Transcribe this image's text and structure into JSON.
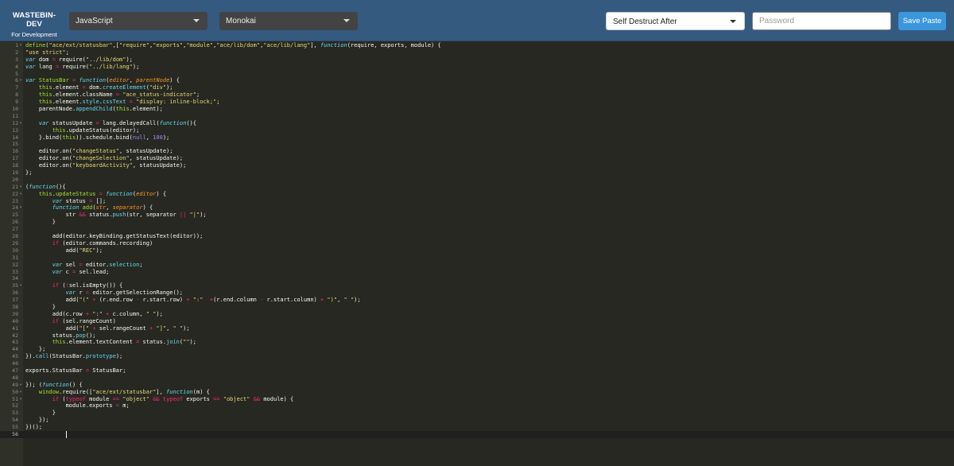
{
  "header": {
    "brand_title": "WASTEBIN-DEV",
    "brand_subtitle": "For Development",
    "language_select": "JavaScript",
    "theme_select": "Monokai",
    "self_destruct_select": "Self Destruct After",
    "password_placeholder": "Password",
    "save_label": "Save Paste"
  },
  "editor": {
    "active_line": 56,
    "fold_lines": [
      1,
      6,
      12,
      21,
      22,
      24,
      35,
      49,
      50,
      51
    ],
    "lines": [
      [
        [
          "t",
          "define"
        ],
        [
          "",
          "("
        ],
        [
          "s",
          "\"ace/ext/statusbar\""
        ],
        [
          "",
          ",["
        ],
        [
          "s",
          "\"require\""
        ],
        [
          "",
          ","
        ],
        [
          "s",
          "\"exports\""
        ],
        [
          "",
          ","
        ],
        [
          "s",
          "\"module\""
        ],
        [
          "",
          ","
        ],
        [
          "s",
          "\"ace/lib/dom\""
        ],
        [
          "",
          ","
        ],
        [
          "s",
          "\"ace/lib/lang\""
        ],
        [
          "",
          "], "
        ],
        [
          "st",
          "function"
        ],
        [
          "",
          "(require, exports, module) {"
        ]
      ],
      [
        [
          "s",
          "\"use strict\""
        ],
        [
          "",
          ";"
        ]
      ],
      [
        [
          "st",
          "var"
        ],
        [
          "",
          " dom "
        ],
        [
          "k",
          "="
        ],
        [
          "",
          " require("
        ],
        [
          "s",
          "\"../lib/dom\""
        ],
        [
          "",
          ");"
        ]
      ],
      [
        [
          "st",
          "var"
        ],
        [
          "",
          " lang "
        ],
        [
          "k",
          "="
        ],
        [
          "",
          " require("
        ],
        [
          "s",
          "\"../lib/lang\""
        ],
        [
          "",
          ");"
        ]
      ],
      [],
      [
        [
          "st",
          "var"
        ],
        [
          "",
          " "
        ],
        [
          "f",
          "StatusBar"
        ],
        [
          "",
          " "
        ],
        [
          "k",
          "="
        ],
        [
          "",
          " "
        ],
        [
          "st",
          "function"
        ],
        [
          "",
          "("
        ],
        [
          "p",
          "editor"
        ],
        [
          "",
          ", "
        ],
        [
          "p",
          "parentNode"
        ],
        [
          "",
          ") {"
        ]
      ],
      [
        [
          "",
          "    "
        ],
        [
          "t",
          "this"
        ],
        [
          "",
          ".element "
        ],
        [
          "k",
          "="
        ],
        [
          "",
          " dom."
        ],
        [
          "sup",
          "createElement"
        ],
        [
          "",
          "("
        ],
        [
          "s",
          "\"div\""
        ],
        [
          "",
          ");"
        ]
      ],
      [
        [
          "",
          "    "
        ],
        [
          "t",
          "this"
        ],
        [
          "",
          ".element.className "
        ],
        [
          "k",
          "="
        ],
        [
          "",
          " "
        ],
        [
          "s",
          "\"ace_status-indicator\""
        ],
        [
          "",
          ";"
        ]
      ],
      [
        [
          "",
          "    "
        ],
        [
          "t",
          "this"
        ],
        [
          "",
          ".element."
        ],
        [
          "sup",
          "style"
        ],
        [
          "",
          "."
        ],
        [
          "sup",
          "cssText"
        ],
        [
          "",
          " "
        ],
        [
          "k",
          "="
        ],
        [
          "",
          " "
        ],
        [
          "s",
          "\"display: inline-block;\""
        ],
        [
          "",
          ";"
        ]
      ],
      [
        [
          "",
          "    parentNode."
        ],
        [
          "sup",
          "appendChild"
        ],
        [
          "",
          "("
        ],
        [
          "t",
          "this"
        ],
        [
          "",
          ".element);"
        ]
      ],
      [],
      [
        [
          "",
          "    "
        ],
        [
          "st",
          "var"
        ],
        [
          "",
          " statusUpdate "
        ],
        [
          "k",
          "="
        ],
        [
          "",
          " lang.delayedCall("
        ],
        [
          "st",
          "function"
        ],
        [
          "",
          "(){"
        ]
      ],
      [
        [
          "",
          "        "
        ],
        [
          "t",
          "this"
        ],
        [
          "",
          ".updateStatus(editor);"
        ]
      ],
      [
        [
          "",
          "    }.bind("
        ],
        [
          "t",
          "this"
        ],
        [
          "",
          ")).schedule.bind("
        ],
        [
          "n",
          "null"
        ],
        [
          "",
          ", "
        ],
        [
          "n",
          "100"
        ],
        [
          "",
          ");"
        ]
      ],
      [],
      [
        [
          "",
          "    editor.on("
        ],
        [
          "s",
          "\"changeStatus\""
        ],
        [
          "",
          ", statusUpdate);"
        ]
      ],
      [
        [
          "",
          "    editor.on("
        ],
        [
          "s",
          "\"changeSelection\""
        ],
        [
          "",
          ", statusUpdate);"
        ]
      ],
      [
        [
          "",
          "    editor.on("
        ],
        [
          "s",
          "\"keyboardActivity\""
        ],
        [
          "",
          ", statusUpdate);"
        ]
      ],
      [
        [
          "",
          "};"
        ]
      ],
      [],
      [
        [
          "",
          "("
        ],
        [
          "st",
          "function"
        ],
        [
          "",
          "(){"
        ]
      ],
      [
        [
          "",
          "    "
        ],
        [
          "t",
          "this"
        ],
        [
          "",
          "."
        ],
        [
          "f",
          "updateStatus"
        ],
        [
          "",
          " "
        ],
        [
          "k",
          "="
        ],
        [
          "",
          " "
        ],
        [
          "st",
          "function"
        ],
        [
          "",
          "("
        ],
        [
          "p",
          "editor"
        ],
        [
          "",
          ") {"
        ]
      ],
      [
        [
          "",
          "        "
        ],
        [
          "st",
          "var"
        ],
        [
          "",
          " status "
        ],
        [
          "k",
          "="
        ],
        [
          "",
          " [];"
        ]
      ],
      [
        [
          "",
          "        "
        ],
        [
          "st",
          "function"
        ],
        [
          "",
          " "
        ],
        [
          "f",
          "add"
        ],
        [
          "",
          "("
        ],
        [
          "p",
          "str"
        ],
        [
          "",
          ", "
        ],
        [
          "p",
          "separator"
        ],
        [
          "",
          ") {"
        ]
      ],
      [
        [
          "",
          "            str "
        ],
        [
          "k",
          "&&"
        ],
        [
          "",
          " status."
        ],
        [
          "sup",
          "push"
        ],
        [
          "",
          "(str, separator "
        ],
        [
          "k",
          "||"
        ],
        [
          "",
          " "
        ],
        [
          "s",
          "\"|\""
        ],
        [
          "",
          ");"
        ]
      ],
      [
        [
          "",
          "        }"
        ]
      ],
      [],
      [
        [
          "",
          "        add(editor.keyBinding.getStatusText(editor));"
        ]
      ],
      [
        [
          "",
          "        "
        ],
        [
          "k",
          "if"
        ],
        [
          "",
          " (editor.commands.recording)"
        ]
      ],
      [
        [
          "",
          "            add("
        ],
        [
          "s",
          "\"REC\""
        ],
        [
          "",
          ");"
        ]
      ],
      [],
      [
        [
          "",
          "        "
        ],
        [
          "st",
          "var"
        ],
        [
          "",
          " sel "
        ],
        [
          "k",
          "="
        ],
        [
          "",
          " editor."
        ],
        [
          "sup",
          "selection"
        ],
        [
          "",
          ";"
        ]
      ],
      [
        [
          "",
          "        "
        ],
        [
          "st",
          "var"
        ],
        [
          "",
          " c "
        ],
        [
          "k",
          "="
        ],
        [
          "",
          " sel.lead;"
        ]
      ],
      [],
      [
        [
          "",
          "        "
        ],
        [
          "k",
          "if"
        ],
        [
          "",
          " ("
        ],
        [
          "k",
          "!"
        ],
        [
          "",
          "sel.isEmpty()) {"
        ]
      ],
      [
        [
          "",
          "            "
        ],
        [
          "st",
          "var"
        ],
        [
          "",
          " r "
        ],
        [
          "k",
          "="
        ],
        [
          "",
          " editor.getSelectionRange();"
        ]
      ],
      [
        [
          "",
          "            add("
        ],
        [
          "s",
          "\"(\""
        ],
        [
          "",
          " "
        ],
        [
          "k",
          "+"
        ],
        [
          "",
          " (r.end.row "
        ],
        [
          "k",
          "-"
        ],
        [
          "",
          " r.start.row) "
        ],
        [
          "k",
          "+"
        ],
        [
          "",
          " "
        ],
        [
          "s",
          "\":\""
        ],
        [
          "",
          "  "
        ],
        [
          "k",
          "+"
        ],
        [
          "",
          "(r.end.column "
        ],
        [
          "k",
          "-"
        ],
        [
          "",
          " r.start.column) "
        ],
        [
          "k",
          "+"
        ],
        [
          "",
          " "
        ],
        [
          "s",
          "\")\""
        ],
        [
          "",
          ", "
        ],
        [
          "s",
          "\" \""
        ],
        [
          "",
          ");"
        ]
      ],
      [
        [
          "",
          "        }"
        ]
      ],
      [
        [
          "",
          "        add(c.row "
        ],
        [
          "k",
          "+"
        ],
        [
          "",
          " "
        ],
        [
          "s",
          "\":\""
        ],
        [
          "",
          " "
        ],
        [
          "k",
          "+"
        ],
        [
          "",
          " c.column, "
        ],
        [
          "s",
          "\" \""
        ],
        [
          "",
          ");"
        ]
      ],
      [
        [
          "",
          "        "
        ],
        [
          "k",
          "if"
        ],
        [
          "",
          " (sel.rangeCount)"
        ]
      ],
      [
        [
          "",
          "            add("
        ],
        [
          "s",
          "\"[\""
        ],
        [
          "",
          " "
        ],
        [
          "k",
          "+"
        ],
        [
          "",
          " sel.rangeCount "
        ],
        [
          "k",
          "+"
        ],
        [
          "",
          " "
        ],
        [
          "s",
          "\"]\""
        ],
        [
          "",
          ", "
        ],
        [
          "s",
          "\" \""
        ],
        [
          "",
          ");"
        ]
      ],
      [
        [
          "",
          "        status."
        ],
        [
          "sup",
          "pop"
        ],
        [
          "",
          "();"
        ]
      ],
      [
        [
          "",
          "        "
        ],
        [
          "t",
          "this"
        ],
        [
          "",
          ".element.textContent "
        ],
        [
          "k",
          "="
        ],
        [
          "",
          " status."
        ],
        [
          "sup",
          "join"
        ],
        [
          "",
          "("
        ],
        [
          "s",
          "\"\""
        ],
        [
          "",
          ");"
        ]
      ],
      [
        [
          "",
          "    };"
        ]
      ],
      [
        [
          "",
          "})."
        ],
        [
          "sup",
          "call"
        ],
        [
          "",
          "(StatusBar."
        ],
        [
          "sup",
          "prototype"
        ],
        [
          "",
          ");"
        ]
      ],
      [],
      [
        [
          "",
          "exports.StatusBar "
        ],
        [
          "k",
          "="
        ],
        [
          "",
          " StatusBar;"
        ]
      ],
      [],
      [
        [
          "",
          "}); ("
        ],
        [
          "st",
          "function"
        ],
        [
          "",
          "() {"
        ]
      ],
      [
        [
          "",
          "    "
        ],
        [
          "t",
          "window"
        ],
        [
          "",
          ".require(["
        ],
        [
          "s",
          "\"ace/ext/statusbar\""
        ],
        [
          "",
          "], "
        ],
        [
          "st",
          "function"
        ],
        [
          "",
          "(m) {"
        ]
      ],
      [
        [
          "",
          "        "
        ],
        [
          "k",
          "if"
        ],
        [
          "",
          " ("
        ],
        [
          "k",
          "typeof"
        ],
        [
          "",
          " module "
        ],
        [
          "k",
          "=="
        ],
        [
          "",
          " "
        ],
        [
          "s",
          "\"object\""
        ],
        [
          "",
          " "
        ],
        [
          "k",
          "&&"
        ],
        [
          "",
          " "
        ],
        [
          "k",
          "typeof"
        ],
        [
          "",
          " exports "
        ],
        [
          "k",
          "=="
        ],
        [
          "",
          " "
        ],
        [
          "s",
          "\"object\""
        ],
        [
          "",
          " "
        ],
        [
          "k",
          "&&"
        ],
        [
          "",
          " module) {"
        ]
      ],
      [
        [
          "",
          "            module.exports "
        ],
        [
          "k",
          "="
        ],
        [
          "",
          " m;"
        ]
      ],
      [
        [
          "",
          "        }"
        ]
      ],
      [
        [
          "",
          "    });"
        ]
      ],
      [
        [
          "",
          "})();"
        ]
      ],
      [
        [
          "",
          "            "
        ]
      ]
    ]
  }
}
